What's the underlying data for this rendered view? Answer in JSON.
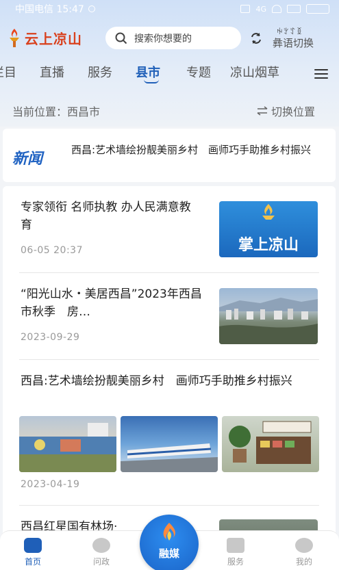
{
  "status_bar": {
    "carrier_time": "中国电信 15:47",
    "battery": "4G"
  },
  "header": {
    "logo_text": "云上凉山",
    "search_placeholder": "搜索你想要的",
    "yi_script": "ꑭꇬꄸꅉ",
    "lang_switch_label": "彝语切换"
  },
  "tabs": [
    {
      "label": "栏目"
    },
    {
      "label": "直播"
    },
    {
      "label": "服务"
    },
    {
      "label": "县市",
      "active": true
    },
    {
      "label": "专题"
    },
    {
      "label": "凉山烟草"
    }
  ],
  "location": {
    "current": "当前位置：西昌市",
    "switch": "切换位置"
  },
  "news_banner": {
    "badge": "新闻",
    "headline": "西昌:艺术墙绘扮靓美丽乡村　画师巧手助推乡村振兴"
  },
  "articles": [
    {
      "title": "专家领衔 名师执教 办人民满意教育",
      "date": "06-05 20:37",
      "thumb_text": "掌上凉山"
    },
    {
      "title": "“阳光山水・美居西昌”2023年西昌市秋季　房…",
      "date": "2023-09-29"
    },
    {
      "title": "西昌:艺术墙绘扮靓美丽乡村　画师巧手助推乡村振兴",
      "date": "2023-04-19"
    },
    {
      "title": "西昌红星国有林场·"
    }
  ],
  "bottom_nav": {
    "home": "首页",
    "ask": "问政",
    "media": "融媒",
    "service": "服务",
    "mine": "我的"
  },
  "colors": {
    "accent": "#1f5fb8",
    "logo": "#d9411e"
  }
}
